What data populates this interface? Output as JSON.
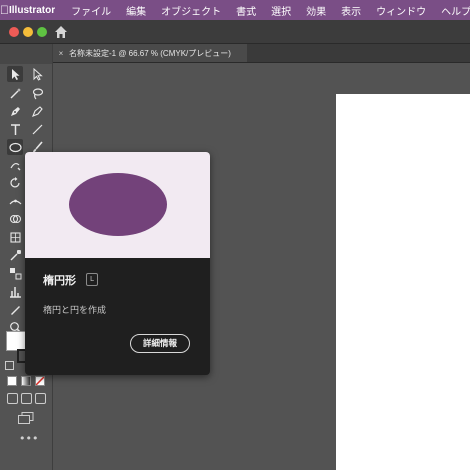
{
  "menubar": {
    "app_name": "Illustrator",
    "items": [
      "ファイル",
      "編集",
      "オブジェクト",
      "書式",
      "選択",
      "効果",
      "表示",
      "ウィンドウ",
      "ヘルプ"
    ]
  },
  "document_tab": {
    "title": "名称未設定-1 @ 66.67 % (CMYK/プレビュー)",
    "close_glyph": "×"
  },
  "tooltip": {
    "tool_name": "楕円形",
    "shortcut": "L",
    "description": "楕円と円を作成",
    "more_button": "詳細情報",
    "preview_color": "#73427a"
  },
  "colors": {
    "menubar": "#7a4e86",
    "panel": "#535353",
    "accent_shape": "#73427a"
  }
}
